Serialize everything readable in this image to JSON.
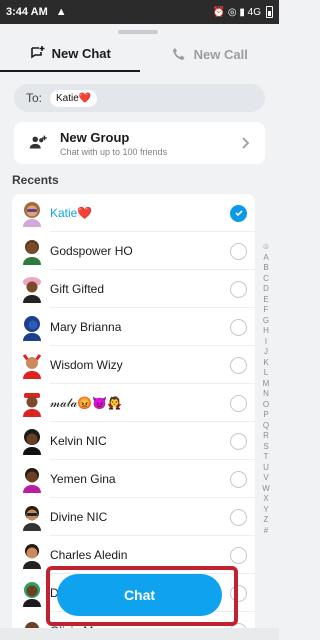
{
  "status_bar": {
    "time": "3:44 AM",
    "warning_glyph": "▲",
    "right_glyphs": "⏰ ◎ ▮ 4G"
  },
  "tabs": [
    {
      "label": "New Chat",
      "icon": "new-chat-icon",
      "active": true
    },
    {
      "label": "New Call",
      "icon": "phone-icon",
      "active": false
    }
  ],
  "to_field": {
    "label": "To:",
    "chip": "Katie❤️"
  },
  "new_group": {
    "title": "New Group",
    "subtitle": "Chat with up to 100 friends"
  },
  "recents_label": "Recents",
  "contacts": [
    {
      "name": "Katie❤️",
      "selected": true
    },
    {
      "name": "Godspower HO",
      "selected": false
    },
    {
      "name": "Gift Gifted",
      "selected": false
    },
    {
      "name": "Mary Brianna",
      "selected": false
    },
    {
      "name": "Wisdom Wizy",
      "selected": false
    },
    {
      "name": "𝓂𝒶𝓁𝒶😡😈🧛",
      "selected": false
    },
    {
      "name": "Kelvin NIC",
      "selected": false
    },
    {
      "name": "Yemen Gina",
      "selected": false
    },
    {
      "name": "Divine NIC",
      "selected": false
    },
    {
      "name": "Charles Aledin",
      "selected": false
    },
    {
      "name": "D",
      "selected": false
    },
    {
      "name": "Olivia M",
      "selected": false
    }
  ],
  "alphabet_index": [
    "☺",
    "A",
    "B",
    "C",
    "D",
    "E",
    "F",
    "G",
    "H",
    "I",
    "J",
    "K",
    "L",
    "M",
    "N",
    "O",
    "P",
    "Q",
    "R",
    "S",
    "T",
    "U",
    "V",
    "W",
    "X",
    "Y",
    "Z",
    "#"
  ],
  "chat_button": {
    "label": "Chat"
  },
  "colors": {
    "accent": "#0fa3ef",
    "highlight": "#c0232f",
    "selected_name": "#0ea5e9"
  }
}
